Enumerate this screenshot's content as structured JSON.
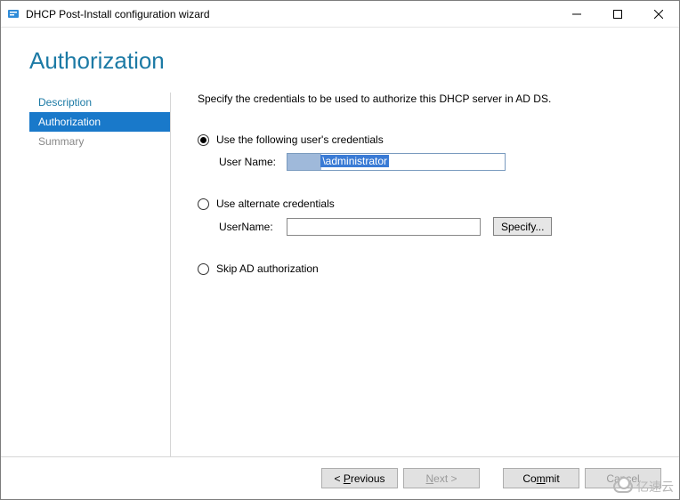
{
  "window": {
    "title": "DHCP Post-Install configuration wizard"
  },
  "heading": "Authorization",
  "sidebar": {
    "items": [
      {
        "label": "Description",
        "state": "link"
      },
      {
        "label": "Authorization",
        "state": "active"
      },
      {
        "label": "Summary",
        "state": "disabled"
      }
    ]
  },
  "content": {
    "instruction": "Specify the credentials to be used to authorize this DHCP server in AD DS.",
    "opt1": {
      "label": "Use the following user's credentials",
      "field_label": "User Name:",
      "value_visible": "\\administrator",
      "checked": true
    },
    "opt2": {
      "label": "Use alternate credentials",
      "field_label": "UserName:",
      "value": "",
      "specify_label": "Specify...",
      "checked": false
    },
    "opt3": {
      "label": "Skip AD authorization",
      "checked": false
    }
  },
  "footer": {
    "previous": "Previous",
    "next": "Next",
    "commit": "Commit",
    "cancel": "Cancel"
  },
  "watermark": "亿速云"
}
